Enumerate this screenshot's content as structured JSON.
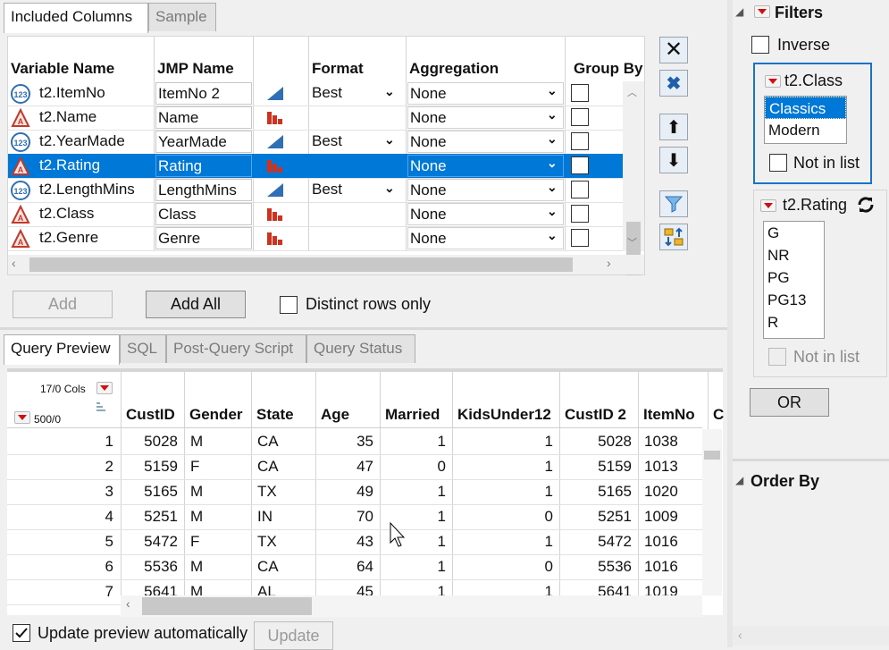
{
  "top_tabs": [
    {
      "label": "Included Columns"
    },
    {
      "label": "Sample"
    }
  ],
  "columns_table": {
    "headers": [
      "Variable Name",
      "JMP Name",
      "Format",
      "Aggregation",
      "Group By"
    ],
    "rows": [
      {
        "type": "numeric",
        "var": "t2.ItemNo",
        "jmp": "ItemNo 2",
        "format": "Best",
        "agg": "None",
        "selected": false
      },
      {
        "type": "character",
        "var": "t2.Name",
        "jmp": "Name",
        "format": "",
        "agg": "None",
        "selected": false
      },
      {
        "type": "numeric",
        "var": "t2.YearMade",
        "jmp": "YearMade",
        "format": "Best",
        "agg": "None",
        "selected": false
      },
      {
        "type": "character",
        "var": "t2.Rating",
        "jmp": "Rating",
        "format": "",
        "agg": "None",
        "selected": true
      },
      {
        "type": "numeric",
        "var": "t2.LengthMins",
        "jmp": "LengthMins",
        "format": "Best",
        "agg": "None",
        "selected": false
      },
      {
        "type": "character",
        "var": "t2.Class",
        "jmp": "Class",
        "format": "",
        "agg": "None",
        "selected": false
      },
      {
        "type": "character",
        "var": "t2.Genre",
        "jmp": "Genre",
        "format": "",
        "agg": "None",
        "selected": false
      }
    ]
  },
  "add_label": "Add",
  "add_all_label": "Add All",
  "distinct_label": "Distinct rows only",
  "bottom_tabs": [
    {
      "label": "Query Preview"
    },
    {
      "label": "SQL"
    },
    {
      "label": "Post-Query Script"
    },
    {
      "label": "Query Status"
    }
  ],
  "preview": {
    "cols_badge": "17/0 Cols",
    "rows_badge": "500/0",
    "headers": [
      "CustID",
      "Gender",
      "State",
      "Age",
      "Married",
      "KidsUnder12",
      "CustID 2",
      "ItemNo",
      "C"
    ],
    "rows": [
      [
        "1",
        "5028",
        "M",
        "CA",
        "35",
        "1",
        "1",
        "5028",
        "1038"
      ],
      [
        "2",
        "5159",
        "F",
        "CA",
        "47",
        "0",
        "1",
        "5159",
        "1013"
      ],
      [
        "3",
        "5165",
        "M",
        "TX",
        "49",
        "1",
        "1",
        "5165",
        "1020"
      ],
      [
        "4",
        "5251",
        "M",
        "IN",
        "70",
        "1",
        "0",
        "5251",
        "1009"
      ],
      [
        "5",
        "5472",
        "F",
        "TX",
        "43",
        "1",
        "1",
        "5472",
        "1016"
      ],
      [
        "6",
        "5536",
        "M",
        "CA",
        "64",
        "1",
        "0",
        "5536",
        "1016"
      ],
      [
        "7",
        "5641",
        "M",
        "AL",
        "45",
        "1",
        "1",
        "5641",
        "1019"
      ]
    ]
  },
  "update_auto_label": "Update preview automatically",
  "update_label": "Update",
  "filters": {
    "title": "Filters",
    "inverse_label": "Inverse",
    "class_filter": {
      "title": "t2.Class",
      "options": [
        "Classics",
        "Modern"
      ],
      "selected": "Classics",
      "not_in_list": "Not in list"
    },
    "rating_filter": {
      "title": "t2.Rating",
      "options": [
        "G",
        "NR",
        "PG",
        "PG13",
        "R"
      ],
      "not_in_list": "Not in list"
    },
    "or_label": "OR"
  },
  "order_by": {
    "title": "Order By"
  },
  "colors": {
    "accent": "#0078d7",
    "numeric_icon": "#2f6fb5",
    "char_icon": "#c0392b",
    "bar_icon": "#d0321e"
  }
}
